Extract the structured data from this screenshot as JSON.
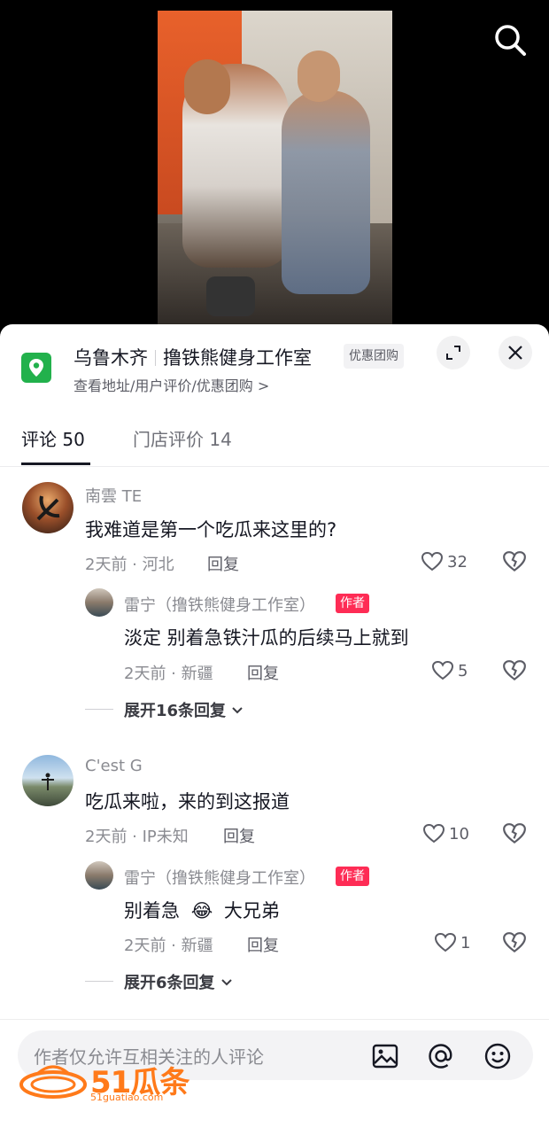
{
  "shop": {
    "city": "乌鲁木齐",
    "name": "撸铁熊健身工作室",
    "deal_tag": "优惠团购",
    "subtitle": "查看地址/用户评价/优惠团购 >"
  },
  "tabs": [
    {
      "label": "评论 50",
      "active": true
    },
    {
      "label": "门店评价 14",
      "active": false
    }
  ],
  "comments": [
    {
      "user": "南雲 TE",
      "text": "我难道是第一个吃瓜来这里的?",
      "meta": "2天前 · 河北",
      "reply_label": "回复",
      "likes": "32",
      "reply": {
        "user": "雷宁（撸铁熊健身工作室）",
        "author_tag": "作者",
        "text": "淡定 别着急铁汁瓜的后续马上就到",
        "meta": "2天前 · 新疆",
        "reply_label": "回复",
        "likes": "5"
      },
      "expand_label": "展开16条回复"
    },
    {
      "user": "C'est G",
      "text": "吃瓜来啦，来的到这报道",
      "meta": "2天前 · IP未知",
      "reply_label": "回复",
      "likes": "10",
      "reply": {
        "user": "雷宁（撸铁熊健身工作室）",
        "author_tag": "作者",
        "text_before": "别着急",
        "emoji": "😂",
        "text_after": "大兄弟",
        "meta": "2天前 · 新疆",
        "reply_label": "回复",
        "likes": "1"
      },
      "expand_label": "展开6条回复"
    }
  ],
  "input": {
    "placeholder": "作者仅允许互相关注的人评论"
  },
  "icons": {
    "search": "search-icon",
    "location": "location-pin-icon",
    "expand": "expand-icon",
    "close": "close-icon",
    "heart": "heart-icon",
    "dislike": "broken-heart-icon",
    "chevron": "chevron-down-icon",
    "image": "image-icon",
    "mention": "at-icon",
    "emoji": "emoji-icon"
  },
  "watermark": {
    "text": "51瓜条",
    "sub": "51guatiao.com"
  },
  "colors": {
    "author_tag": "#fe2c55",
    "location_pin": "#22b14c",
    "watermark": "#ff7a1a"
  }
}
